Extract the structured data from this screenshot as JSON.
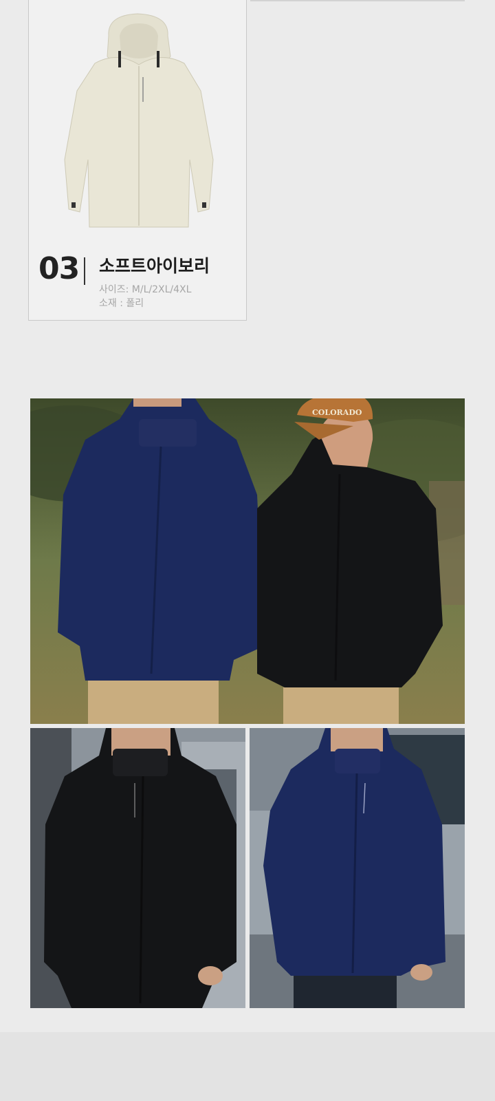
{
  "product": {
    "number": "03",
    "name": "소프트아이보리",
    "size_line": "사이즈: M/L/2XL/4XL",
    "material_line": "소재 : 폴리",
    "colors": {
      "jacket_ivory": "#e9e6d6",
      "navy": "#1c2a5e",
      "black": "#141517"
    }
  },
  "photos": {
    "main_cap_text": "COLORADO"
  }
}
